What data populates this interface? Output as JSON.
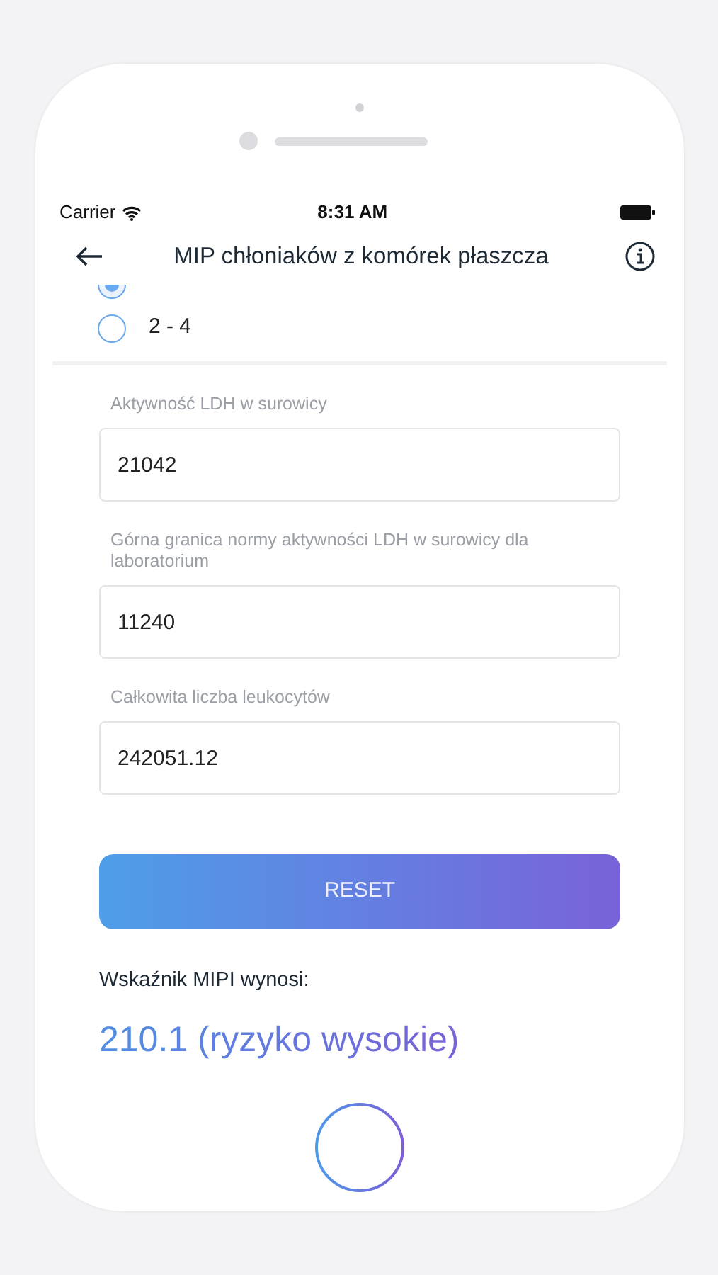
{
  "status_bar": {
    "carrier": "Carrier",
    "time": "8:31 AM"
  },
  "header": {
    "title": "MIP chłoniaków z komórek płaszcza"
  },
  "options": [
    {
      "selected": true
    },
    {
      "label": "2 - 4",
      "selected": false
    }
  ],
  "fields": [
    {
      "label": "Aktywność LDH w surowicy",
      "value": "21042"
    },
    {
      "label": "Górna granica normy aktywności LDH w surowicy dla laboratorium",
      "value": "11240"
    },
    {
      "label": "Całkowita liczba leukocytów",
      "value": "242051.12"
    }
  ],
  "reset_button": "RESET",
  "result": {
    "label": "Wskaźnik MIPI wynosi:",
    "value": "210.1 (ryzyko wysokie)"
  }
}
